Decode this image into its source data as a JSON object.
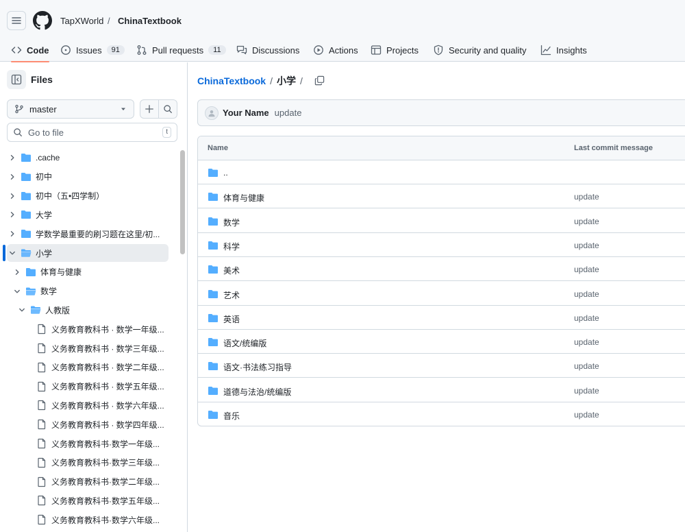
{
  "header": {
    "owner": "TapXWorld",
    "separator": "/",
    "repo": "ChinaTextbook"
  },
  "tabs": [
    {
      "label": "Code",
      "icon": "code-icon",
      "active": true
    },
    {
      "label": "Issues",
      "icon": "issue-icon",
      "count": "91"
    },
    {
      "label": "Pull requests",
      "icon": "pull-request-icon",
      "count": "11"
    },
    {
      "label": "Discussions",
      "icon": "discussions-icon"
    },
    {
      "label": "Actions",
      "icon": "play-icon"
    },
    {
      "label": "Projects",
      "icon": "table-icon"
    },
    {
      "label": "Security and quality",
      "icon": "shield-icon"
    },
    {
      "label": "Insights",
      "icon": "graph-icon"
    }
  ],
  "sidebar": {
    "title": "Files",
    "branch": "master",
    "goto_placeholder": "Go to file",
    "goto_shortcut": "t",
    "tree": [
      {
        "label": ".cache",
        "type": "folder",
        "depth": 0,
        "expanded": false
      },
      {
        "label": "初中",
        "type": "folder",
        "depth": 0,
        "expanded": false
      },
      {
        "label": "初中（五•四学制）",
        "type": "folder",
        "depth": 0,
        "expanded": false
      },
      {
        "label": "大学",
        "type": "folder",
        "depth": 0,
        "expanded": false
      },
      {
        "label": "学数学最重要的刷习题在这里/初...",
        "type": "folder",
        "depth": 0,
        "expanded": false
      },
      {
        "label": "小学",
        "type": "folder",
        "depth": 0,
        "expanded": true,
        "selected": true
      },
      {
        "label": "体育与健康",
        "type": "folder",
        "depth": 1,
        "expanded": false
      },
      {
        "label": "数学",
        "type": "folder",
        "depth": 1,
        "expanded": true
      },
      {
        "label": "人教版",
        "type": "folder",
        "depth": 2,
        "expanded": true
      },
      {
        "label": "义务教育教科书 · 数学一年级...",
        "type": "file",
        "depth": 3
      },
      {
        "label": "义务教育教科书 · 数学三年级...",
        "type": "file",
        "depth": 3
      },
      {
        "label": "义务教育教科书 · 数学二年级...",
        "type": "file",
        "depth": 3
      },
      {
        "label": "义务教育教科书 · 数学五年级...",
        "type": "file",
        "depth": 3
      },
      {
        "label": "义务教育教科书 · 数学六年级...",
        "type": "file",
        "depth": 3
      },
      {
        "label": "义务教育教科书 · 数学四年级...",
        "type": "file",
        "depth": 3
      },
      {
        "label": "义务教育教科书·数学一年级...",
        "type": "file",
        "depth": 3
      },
      {
        "label": "义务教育教科书·数学三年级...",
        "type": "file",
        "depth": 3
      },
      {
        "label": "义务教育教科书·数学二年级...",
        "type": "file",
        "depth": 3
      },
      {
        "label": "义务教育教科书·数学五年级...",
        "type": "file",
        "depth": 3
      },
      {
        "label": "义务教育教科书·数学六年级...",
        "type": "file",
        "depth": 3
      }
    ]
  },
  "breadcrumb": {
    "repo": "ChinaTextbook",
    "sep": "/",
    "current": "小学",
    "trailing": "/"
  },
  "commit": {
    "author": "Your Name",
    "message": "update"
  },
  "table": {
    "col_name": "Name",
    "col_message": "Last commit message",
    "rows": [
      {
        "name": "..",
        "message": ""
      },
      {
        "name": "体育与健康",
        "message": "update"
      },
      {
        "name": "数学",
        "message": "update"
      },
      {
        "name": "科学",
        "message": "update"
      },
      {
        "name": "美术",
        "message": "update"
      },
      {
        "name": "艺术",
        "message": "update"
      },
      {
        "name": "英语",
        "message": "update"
      },
      {
        "name": "语文/统编版",
        "message": "update"
      },
      {
        "name": "语文·书法练习指导",
        "message": "update"
      },
      {
        "name": "道德与法治/统编版",
        "message": "update"
      },
      {
        "name": "音乐",
        "message": "update"
      }
    ]
  },
  "colors": {
    "folder": "#54aeff",
    "link": "#0969da",
    "active_tab_underline": "#fd8c73",
    "selected_bar": "#0969da"
  }
}
